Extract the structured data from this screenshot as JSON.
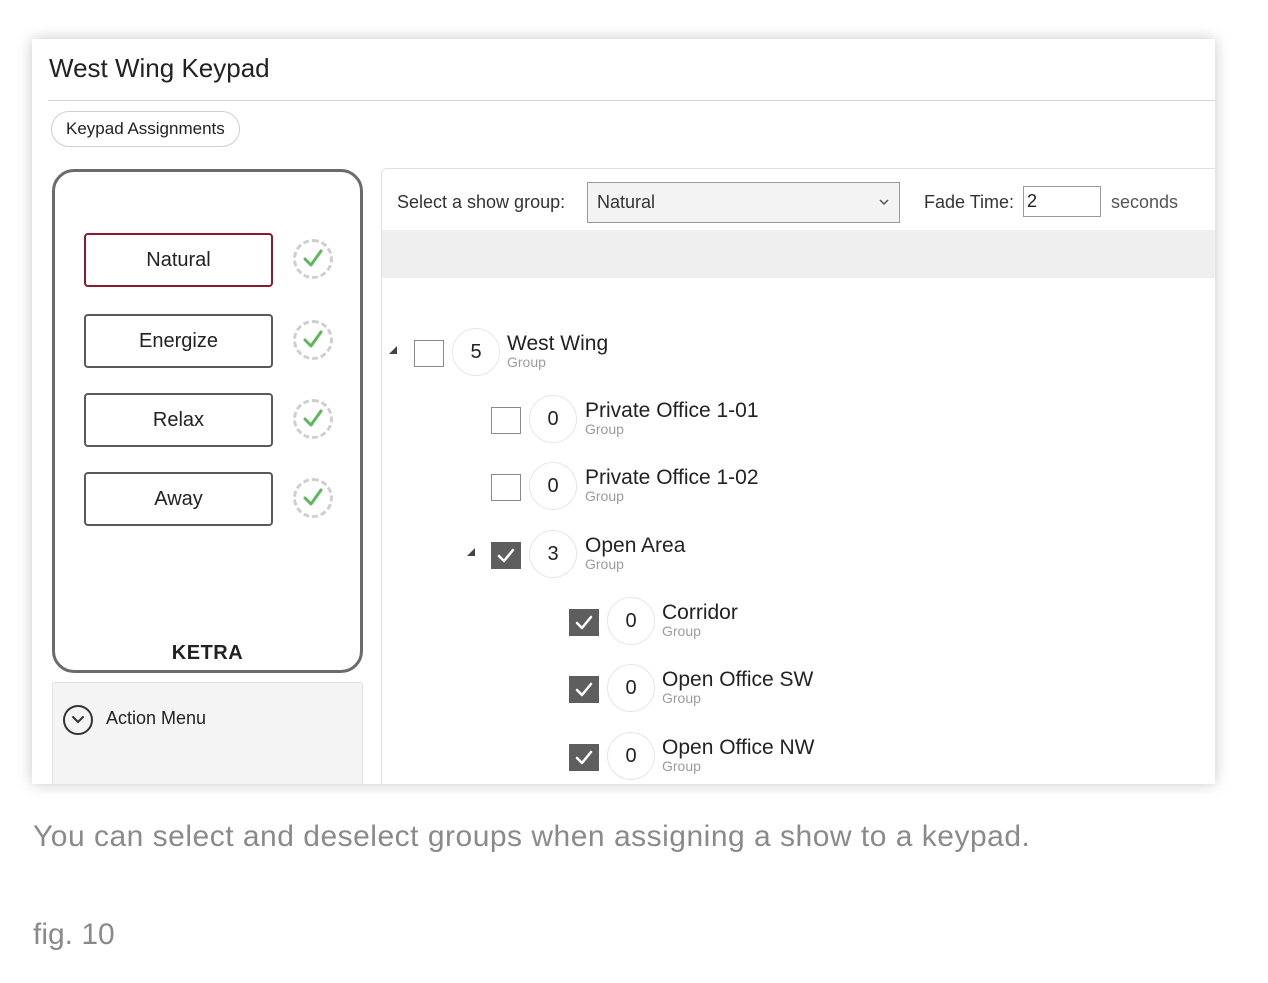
{
  "window": {
    "title": "West Wing Keypad",
    "tab": "Keypad Assignments"
  },
  "keypad": {
    "buttons": [
      {
        "label": "Natural",
        "selected": true,
        "assigned": true
      },
      {
        "label": "Energize",
        "selected": false,
        "assigned": true
      },
      {
        "label": "Relax",
        "selected": false,
        "assigned": true
      },
      {
        "label": "Away",
        "selected": false,
        "assigned": true
      }
    ],
    "brand": "KETRA",
    "selected_color": "#8b1a2c",
    "check_color": "#5cb85c"
  },
  "action_menu": {
    "label": "Action Menu",
    "icon": "chevron-down-circle-icon"
  },
  "controls": {
    "show_group_label": "Select a show group:",
    "show_group_value": "Natural",
    "fade_label": "Fade Time:",
    "fade_value": "2",
    "fade_unit": "seconds"
  },
  "tree": [
    {
      "name": "West Wing",
      "type": "Group",
      "count": "5",
      "checked": false,
      "expanded": true,
      "level": 0
    },
    {
      "name": "Private Office 1-01",
      "type": "Group",
      "count": "0",
      "checked": false,
      "level": 1
    },
    {
      "name": "Private Office 1-02",
      "type": "Group",
      "count": "0",
      "checked": false,
      "level": 1
    },
    {
      "name": "Open Area",
      "type": "Group",
      "count": "3",
      "checked": true,
      "expanded": true,
      "level": 1
    },
    {
      "name": "Corridor",
      "type": "Group",
      "count": "0",
      "checked": true,
      "level": 2
    },
    {
      "name": "Open Office SW",
      "type": "Group",
      "count": "0",
      "checked": true,
      "level": 2
    },
    {
      "name": "Open Office NW",
      "type": "Group",
      "count": "0",
      "checked": true,
      "level": 2
    }
  ],
  "caption": "You can select and deselect groups when assigning a show to a keypad.",
  "figure_label": "fig. 10"
}
